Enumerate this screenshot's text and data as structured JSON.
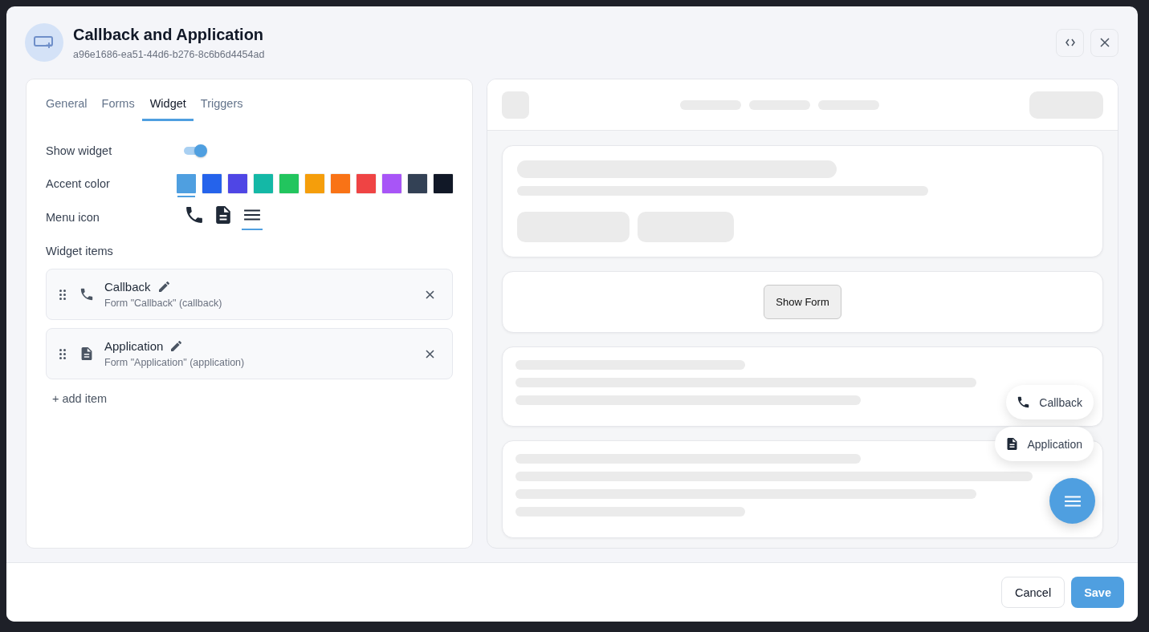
{
  "header": {
    "title": "Callback and Application",
    "id": "a96e1686-ea51-44d6-b276-8c6b6d4454ad"
  },
  "tabs": [
    {
      "label": "General",
      "selected": false
    },
    {
      "label": "Forms",
      "selected": false
    },
    {
      "label": "Widget",
      "selected": true
    },
    {
      "label": "Triggers",
      "selected": false
    }
  ],
  "show_widget": {
    "label": "Show widget",
    "on": true
  },
  "accent_color": {
    "label": "Accent color",
    "swatches": [
      {
        "color": "#4f9fe0",
        "selected": true
      },
      {
        "color": "#2563eb",
        "selected": false
      },
      {
        "color": "#4f46e5",
        "selected": false
      },
      {
        "color": "#14b8a6",
        "selected": false
      },
      {
        "color": "#22c55e",
        "selected": false
      },
      {
        "color": "#f59e0b",
        "selected": false
      },
      {
        "color": "#f97316",
        "selected": false
      },
      {
        "color": "#ef4444",
        "selected": false
      },
      {
        "color": "#a855f7",
        "selected": false
      },
      {
        "color": "#334155",
        "selected": false
      },
      {
        "color": "#111827",
        "selected": false
      }
    ]
  },
  "menu_icon": {
    "label": "Menu icon",
    "options": [
      {
        "kind": "phone",
        "selected": false
      },
      {
        "kind": "document",
        "selected": false
      },
      {
        "kind": "menu",
        "selected": true
      }
    ]
  },
  "widget_items": {
    "label": "Widget items",
    "items": [
      {
        "kind": "phone",
        "title": "Callback",
        "subtitle": "Form \"Callback\" (callback)"
      },
      {
        "kind": "document",
        "title": "Application",
        "subtitle": "Form \"Application\" (application)"
      }
    ],
    "add_label": "+ add item"
  },
  "preview": {
    "show_form_label": "Show Form",
    "fab_items": [
      {
        "kind": "phone",
        "label": "Callback"
      },
      {
        "kind": "document",
        "label": "Application"
      }
    ],
    "launcher": {
      "kind": "menu"
    }
  },
  "footer": {
    "cancel": "Cancel",
    "save": "Save"
  }
}
